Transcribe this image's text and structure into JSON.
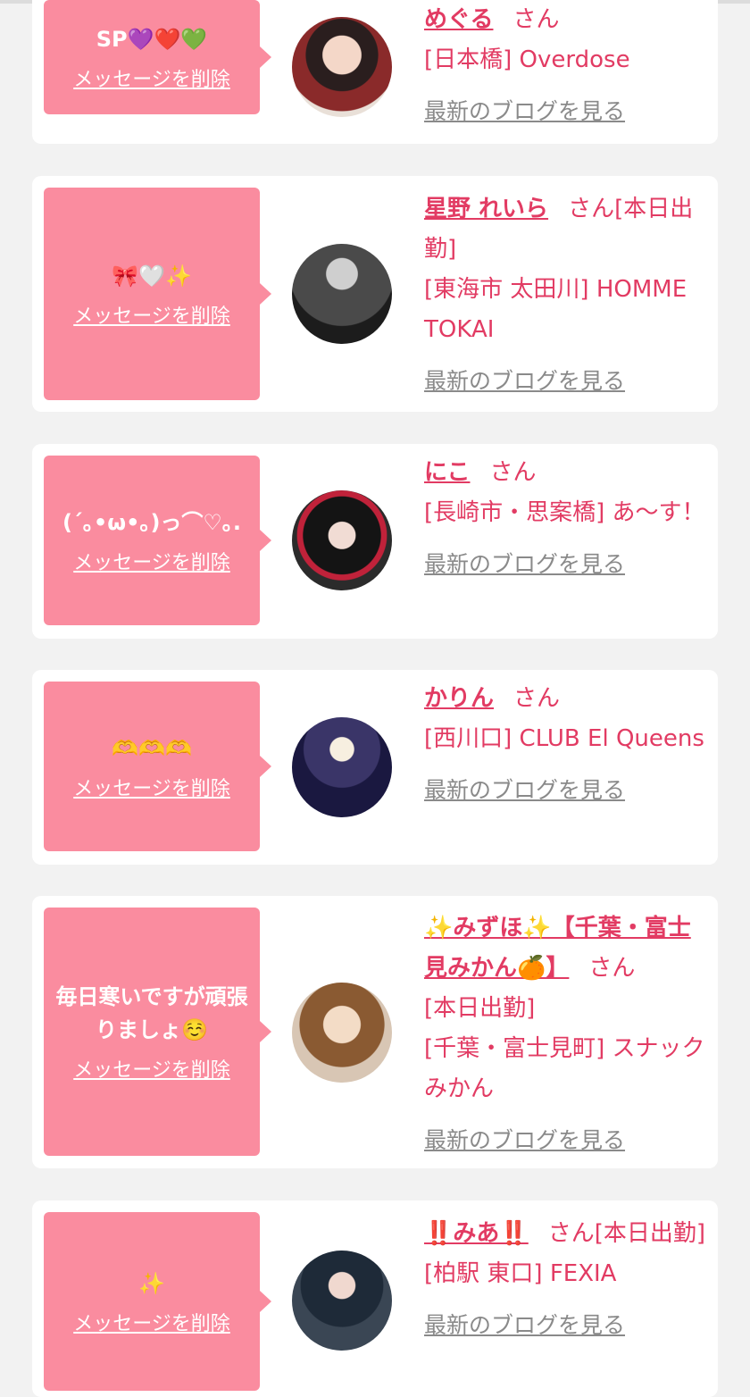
{
  "delete_label": "メッセージを削除",
  "blog_label": "最新のブログを見る",
  "san_label": "さん",
  "colors": {
    "bubble": "#fa8c9f",
    "accent": "#e23b63",
    "link_gray": "#8a8a8a",
    "background": "#f2f2f2"
  },
  "cards": [
    {
      "message": "SP💜❤️💚",
      "name": "めぐる",
      "after_name": "",
      "lines": [
        "[日本橋] Overdose"
      ]
    },
    {
      "message": "🎀🤍✨",
      "name": "星野 れいら",
      "after_name": "[本日出勤]",
      "lines": [
        "[東海市 太田川] HOMME TOKAI"
      ]
    },
    {
      "message": "(´｡•ω•｡)っ⌒♡｡.",
      "name": "にこ",
      "after_name": "",
      "lines": [
        "[長崎市・思案橋] あ〜す！"
      ]
    },
    {
      "message": "🫶🫶🫶",
      "name": "かりん",
      "after_name": "",
      "lines": [
        "[西川口] CLUB El Queens"
      ]
    },
    {
      "message": "毎日寒いですが頑張りましょ☺️",
      "name": "✨みずほ✨【千葉・富士見みかん🍊】",
      "after_name": "",
      "lines": [
        "[本日出勤]",
        "[千葉・富士見町] スナックみかん"
      ]
    },
    {
      "message": "✨",
      "name": "‼️みあ‼️",
      "after_name": "[本日出勤]",
      "lines": [
        "[柏駅 東口] FEXIA"
      ]
    }
  ]
}
